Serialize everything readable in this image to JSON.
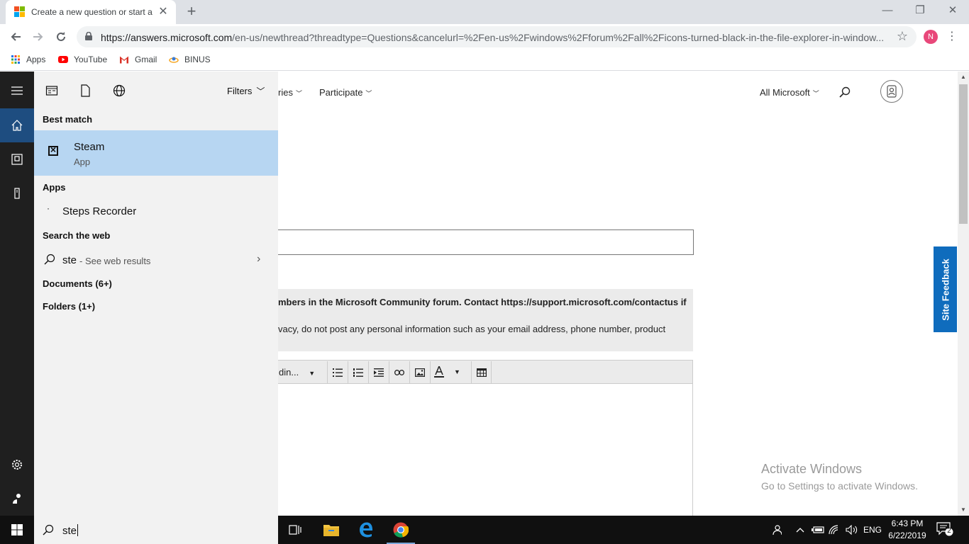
{
  "browser": {
    "tab_title": "Create a new question or start a",
    "tab_close": "✕",
    "new_tab": "+",
    "window_minimize": "—",
    "window_restore": "❐",
    "window_close": "✕",
    "url_host": "https://answers.microsoft.com",
    "url_rest": "/en-us/newthread?threadtype=Questions&cancelurl=%2Fen-us%2Fwindows%2Fforum%2Fall%2Ficons-turned-black-in-the-file-explorer-in-window...",
    "profile_initial": "N",
    "bookmarks": [
      "Apps",
      "YouTube",
      "Gmail",
      "BINUS"
    ]
  },
  "page": {
    "nav": {
      "categories_partial": "ries",
      "participate": "Participate",
      "all_microsoft": "All Microsoft"
    },
    "notice_line1": "mbers in the Microsoft Community forum. Contact https://support.microsoft.com/contactus if",
    "notice_line2": "vacy, do not post any personal information such as your email address, phone number, product",
    "editor_heading": "din...",
    "activate_title": "Activate Windows",
    "activate_sub": "Go to Settings to activate Windows.",
    "site_feedback": "Site Feedback"
  },
  "search_panel": {
    "filters_label": "Filters",
    "best_match_heading": "Best match",
    "best_match": {
      "name": "Steam",
      "kind": "App"
    },
    "apps_heading": "Apps",
    "apps": [
      {
        "name": "Steps Recorder"
      }
    ],
    "web_heading": "Search the web",
    "web_query": "ste",
    "web_hint": "- See web results",
    "documents_heading": "Documents (6+)",
    "folders_heading": "Folders (1+)"
  },
  "taskbar": {
    "search_text": "ste",
    "language": "ENG",
    "time": "6:43 PM",
    "date": "6/22/2019",
    "notification_count": "2"
  },
  "colors": {
    "selection": "#b7d6f2",
    "site_feedback": "#0f6cbd",
    "taskbar": "#101010"
  }
}
